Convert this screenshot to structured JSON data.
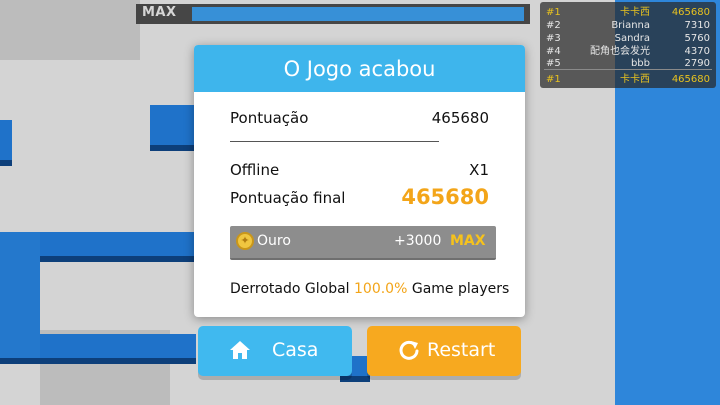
{
  "topbar": {
    "max_label": "MAX",
    "progress": 1.0
  },
  "leaderboard": {
    "rows": [
      {
        "rank": "#1",
        "name": "卡卡西",
        "score": "465680",
        "highlight": true
      },
      {
        "rank": "#2",
        "name": "Brianna",
        "score": "7310",
        "highlight": false
      },
      {
        "rank": "#3",
        "name": "Sandra",
        "score": "5760",
        "highlight": false
      },
      {
        "rank": "#4",
        "name": "配角也会发光",
        "score": "4370",
        "highlight": false
      },
      {
        "rank": "#5",
        "name": "bbb",
        "score": "2790",
        "highlight": false
      }
    ],
    "self": {
      "rank": "#1",
      "name": "卡卡西",
      "score": "465680"
    }
  },
  "dialog": {
    "title": "O Jogo acabou",
    "score_label": "Pontuação",
    "score_value": "465680",
    "offline_label": "Offline",
    "offline_value": "X1",
    "final_label": "Pontuação final",
    "final_value": "465680",
    "gold": {
      "label": "Ouro",
      "value": "+3000",
      "max": "MAX"
    },
    "defeat": {
      "prefix": "Derrotado Global",
      "percent": "100.0%",
      "suffix": "Game players"
    }
  },
  "buttons": {
    "home": "Casa",
    "restart": "Restart"
  },
  "icons": {
    "home": "home-icon",
    "restart": "restart-icon",
    "coin": "coin-icon"
  },
  "colors": {
    "accent_blue": "#3eb5ec",
    "accent_orange": "#f7a91f",
    "score_orange": "#f3a519",
    "gold": "#e8c21f"
  }
}
